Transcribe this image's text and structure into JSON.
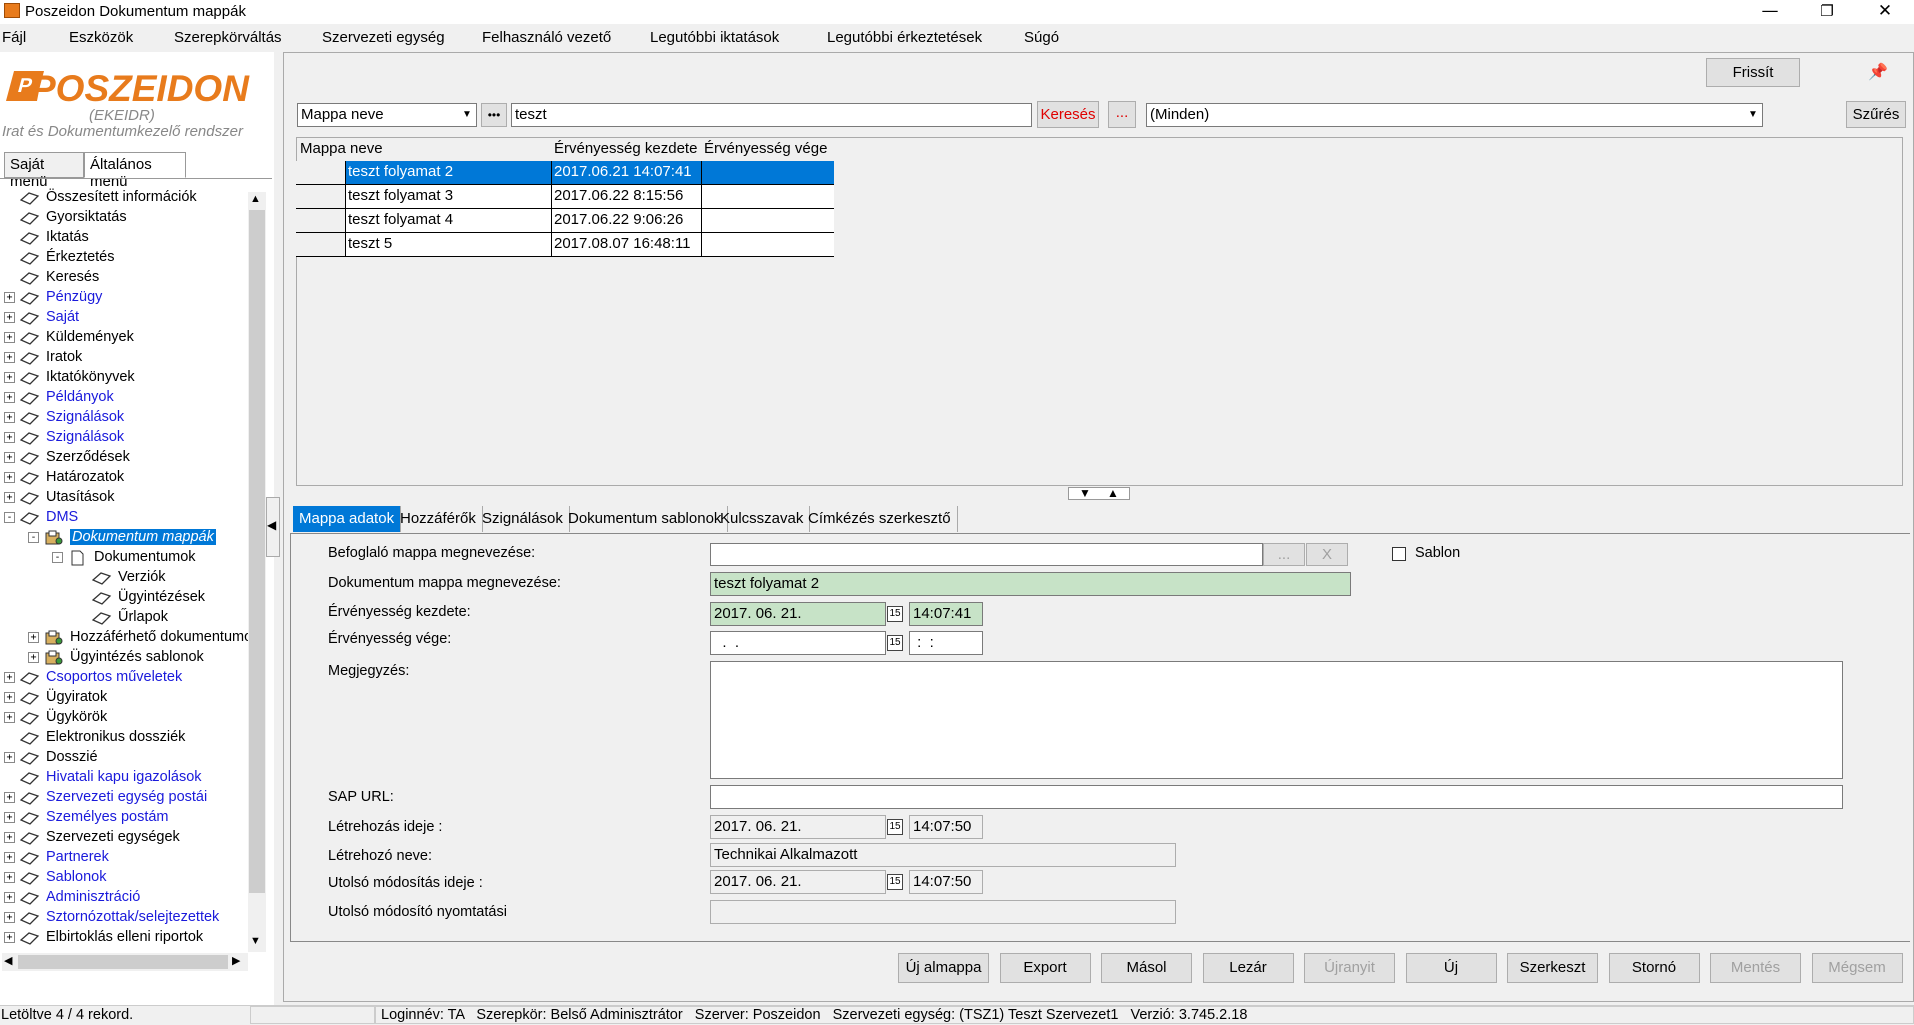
{
  "window": {
    "title": "Poszeidon Dokumentum mappák",
    "minimize": "—",
    "restore": "❐",
    "close": "✕"
  },
  "menu": [
    "Fájl",
    "Eszközök",
    "Szerepkörváltás",
    "Szervezeti egység",
    "Felhasználó vezető",
    "Legutóbbi iktatások",
    "Legutóbbi érkeztetések",
    "Súgó"
  ],
  "logo": {
    "name": "POSZEIDON",
    "sub": "(EKEIDR)",
    "desc": "Irat és Dokumentumkezelő rendszer"
  },
  "left_tabs": [
    "Saját menü",
    "Általános menü"
  ],
  "tree": [
    {
      "label": "Összesített információk",
      "exp": "",
      "blue": false
    },
    {
      "label": "Gyorsiktatás",
      "exp": "",
      "blue": false
    },
    {
      "label": "Iktatás",
      "exp": "",
      "blue": false
    },
    {
      "label": "Érkeztetés",
      "exp": "",
      "blue": false
    },
    {
      "label": "Keresés",
      "exp": "",
      "blue": false
    },
    {
      "label": "Pénzügy",
      "exp": "+",
      "blue": true
    },
    {
      "label": "Saját",
      "exp": "+",
      "blue": true
    },
    {
      "label": "Küldemények",
      "exp": "+",
      "blue": false
    },
    {
      "label": "Iratok",
      "exp": "+",
      "blue": false
    },
    {
      "label": "Iktatókönyvek",
      "exp": "+",
      "blue": false
    },
    {
      "label": "Példányok",
      "exp": "+",
      "blue": true
    },
    {
      "label": "Szignálások",
      "exp": "+",
      "blue": true
    },
    {
      "label": "Szignálások",
      "exp": "+",
      "blue": true
    },
    {
      "label": "Szerződések",
      "exp": "+",
      "blue": false
    },
    {
      "label": "Határozatok",
      "exp": "+",
      "blue": false
    },
    {
      "label": "Utasítások",
      "exp": "+",
      "blue": false
    },
    {
      "label": "DMS",
      "exp": "−",
      "blue": true
    },
    {
      "label": "Dokumentum mappák",
      "exp": "−",
      "blue": false,
      "selected": true
    },
    {
      "label": "Dokumentumok",
      "exp": "−",
      "blue": false
    },
    {
      "label": "Verziók",
      "exp": "",
      "blue": false
    },
    {
      "label": "Ügyintézések",
      "exp": "",
      "blue": false
    },
    {
      "label": "Űrlapok",
      "exp": "",
      "blue": false
    },
    {
      "label": "Hozzáférhető dokumentumok",
      "exp": "+",
      "blue": false
    },
    {
      "label": "Ügyintézés sablonok",
      "exp": "+",
      "blue": false
    },
    {
      "label": "Csoportos műveletek",
      "exp": "+",
      "blue": true
    },
    {
      "label": "Ügyiratok",
      "exp": "+",
      "blue": false
    },
    {
      "label": "Ügykörök",
      "exp": "+",
      "blue": false
    },
    {
      "label": "Elektronikus dossziék",
      "exp": "",
      "blue": false
    },
    {
      "label": "Dosszié",
      "exp": "+",
      "blue": false
    },
    {
      "label": "Hivatali kapu igazolások",
      "exp": "",
      "blue": true
    },
    {
      "label": "Szervezeti egység postái",
      "exp": "+",
      "blue": true
    },
    {
      "label": "Személyes postám",
      "exp": "+",
      "blue": true
    },
    {
      "label": "Szervezeti egységek",
      "exp": "+",
      "blue": false
    },
    {
      "label": "Partnerek",
      "exp": "+",
      "blue": true
    },
    {
      "label": "Sablonok",
      "exp": "+",
      "blue": true
    },
    {
      "label": "Adminisztráció",
      "exp": "+",
      "blue": true
    },
    {
      "label": "Sztornózottak/selejtezettek",
      "exp": "+",
      "blue": true
    },
    {
      "label": "Elbirtoklás elleni riportok",
      "exp": "+",
      "blue": false
    }
  ],
  "toolbar": {
    "refresh": "Frissít",
    "pin": "📌"
  },
  "search": {
    "field": "Mappa neve",
    "dots": "•••",
    "value": "teszt",
    "search_btn": "Keresés",
    "more_btn": "...",
    "filter_value": "(Minden)",
    "filter_btn": "Szűrés"
  },
  "grid": {
    "headers": [
      "Mappa neve",
      "Érvényesség kezdete",
      "Érvényesség vége"
    ],
    "rows": [
      [
        "teszt folyamat 2",
        "2017.06.21 14:07:41",
        ""
      ],
      [
        "teszt folyamat 3",
        "2017.06.22 8:15:56",
        ""
      ],
      [
        "teszt folyamat 4",
        "2017.06.22 9:06:26",
        ""
      ],
      [
        "teszt 5",
        "2017.08.07 16:48:11",
        ""
      ]
    ]
  },
  "detail_tabs": [
    "Mappa adatok",
    "Hozzáférők",
    "Szignálások",
    "Dokumentum sablonok",
    "Kulcsszavak",
    "Címkézés szerkesztő"
  ],
  "form": {
    "befoglalo_label": "Befoglaló mappa megnevezése:",
    "befoglalo_value": "",
    "befoglalo_dots": "...",
    "befoglalo_x": "X",
    "sablon_label": "Sablon",
    "nev_label": "Dokumentum mappa megnevezése:",
    "nev_value": "teszt folyamat 2",
    "kezdete_label": "Érvényesség kezdete:",
    "kezdete_date": "2017. 06. 21.",
    "kezdete_time": "14:07:41",
    "vege_label": "Érvényesség vége:",
    "vege_date": "  .  .",
    "vege_time": " :  :",
    "megjegyzes_label": "Megjegyzés:",
    "sap_label": "SAP URL:",
    "letrehozas_label": "Létrehozás ideje :",
    "letrehozas_date": "2017. 06. 21.",
    "letrehozas_time": "14:07:50",
    "letrehozo_label": "Létrehozó neve:",
    "letrehozo_value": "Technikai Alkalmazott",
    "modositas_label": "Utolsó módosítás ideje :",
    "modositas_date": "2017. 06. 21.",
    "modositas_time": "14:07:50",
    "modosito_label": "Utolsó módosító nyomtatási",
    "modosito_value": "",
    "cal_glyph": "15"
  },
  "buttons": [
    {
      "label": "Új almappa",
      "enabled": true
    },
    {
      "label": "Export",
      "enabled": true
    },
    {
      "label": "Másol",
      "enabled": true
    },
    {
      "label": "Lezár",
      "enabled": true
    },
    {
      "label": "Újranyit",
      "enabled": false
    },
    {
      "label": "Új",
      "enabled": true
    },
    {
      "label": "Szerkeszt",
      "enabled": true
    },
    {
      "label": "Stornó",
      "enabled": true
    },
    {
      "label": "Mentés",
      "enabled": false
    },
    {
      "label": "Mégsem",
      "enabled": false
    }
  ],
  "status": {
    "left": "Letöltve 4 / 4 rekord.",
    "right": "Loginnév: TA   Szerepkör: Belső Adminisztrátor   Szerver: Poszeidon   Szervezeti egység: (TSZ1) Teszt Szervezet1   Verzió: 3.745.2.18"
  },
  "colors": {
    "accent": "#0078d7",
    "logo": "#e87b1c",
    "link": "#1a1adb",
    "field_green": "#c7e3c7",
    "search_red": "#e00000"
  }
}
